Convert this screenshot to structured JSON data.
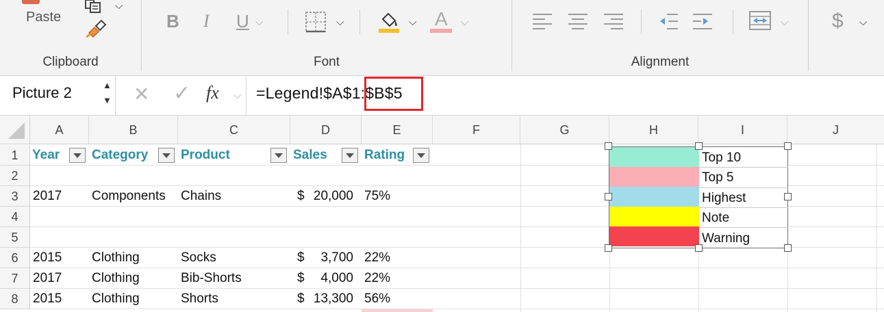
{
  "ribbon": {
    "clipboard": {
      "paste_label": "Paste",
      "group_label": "Clipboard"
    },
    "font": {
      "bold": "B",
      "italic": "I",
      "underline": "U",
      "font_color_letter": "A",
      "group_label": "Font",
      "fill_color": "#f2c12e",
      "font_color": "#f4a7a7"
    },
    "alignment": {
      "group_label": "Alignment"
    },
    "number": {
      "currency_symbol": "$"
    }
  },
  "formula_bar": {
    "name_box": "Picture 2",
    "fx_label": "fx",
    "cancel_glyph": "✕",
    "enter_glyph": "✓",
    "formula": "=Legend!$A$1:$B$5"
  },
  "grid": {
    "columns": [
      "A",
      "B",
      "C",
      "D",
      "E",
      "F",
      "G",
      "H",
      "I",
      "J"
    ],
    "rows": [
      "1",
      "2",
      "3",
      "4",
      "5",
      "6",
      "7",
      "8"
    ],
    "header_row": {
      "year": "Year",
      "category": "Category",
      "product": "Product",
      "sales": "Sales",
      "rating": "Rating"
    },
    "data_rows": [
      {
        "row": "3",
        "year": "2017",
        "category": "Components",
        "product": "Chains",
        "sales_symbol": "$",
        "sales": "20,000",
        "rating": "75%"
      },
      {
        "row": "6",
        "year": "2015",
        "category": "Clothing",
        "product": "Socks",
        "sales_symbol": "$",
        "sales": "3,700",
        "rating": "22%"
      },
      {
        "row": "7",
        "year": "2017",
        "category": "Clothing",
        "product": "Bib-Shorts",
        "sales_symbol": "$",
        "sales": "4,000",
        "rating": "22%"
      },
      {
        "row": "8",
        "year": "2015",
        "category": "Clothing",
        "product": "Shorts",
        "sales_symbol": "$",
        "sales": "13,300",
        "rating": "56%"
      }
    ]
  },
  "legend": {
    "items": [
      {
        "label": "Top 10",
        "color": "#98ecd4"
      },
      {
        "label": "Top 5",
        "color": "#f9afb5"
      },
      {
        "label": "Highest",
        "color": "#a2dbe9"
      },
      {
        "label": "Note",
        "color": "#ffff00"
      },
      {
        "label": "Warning",
        "color": "#f2434f"
      }
    ]
  },
  "colors": {
    "header_text": "#2e8fa3",
    "highlight_border": "#e0262b"
  }
}
